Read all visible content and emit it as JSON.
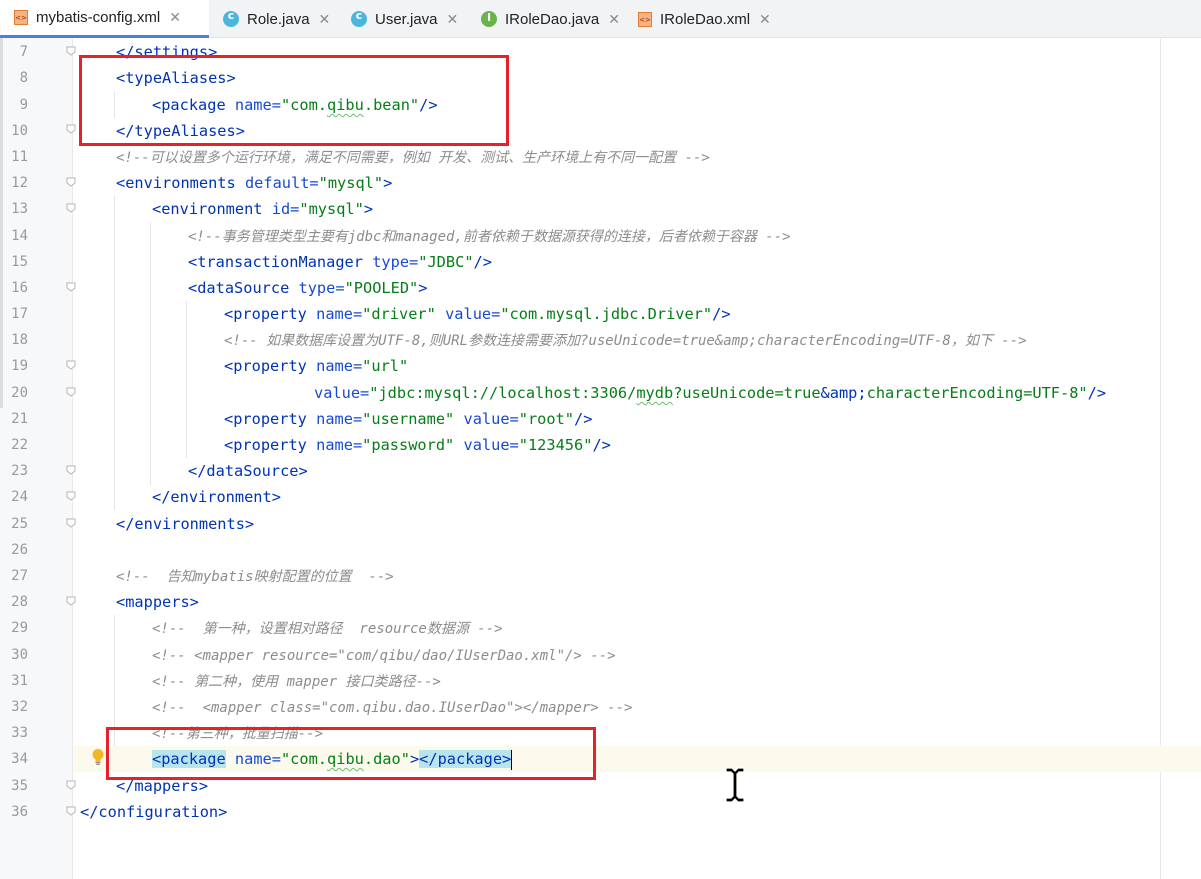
{
  "tabs": [
    {
      "label": "mybatis-config.xml",
      "icon": "xml-file-icon",
      "active": true
    },
    {
      "label": "Role.java",
      "icon": "class-icon"
    },
    {
      "label": "User.java",
      "icon": "class-icon"
    },
    {
      "label": "IRoleDao.java",
      "icon": "interface-icon"
    },
    {
      "label": "IRoleDao.xml",
      "icon": "xml-file-icon"
    }
  ],
  "close_glyph": "✕",
  "line_numbers": [
    "7",
    "8",
    "9",
    "10",
    "11",
    "12",
    "13",
    "14",
    "15",
    "16",
    "17",
    "18",
    "19",
    "20",
    "21",
    "22",
    "23",
    "24",
    "25",
    "26",
    "27",
    "28",
    "29",
    "30",
    "31",
    "32",
    "33",
    "34",
    "35",
    "36"
  ],
  "code": {
    "l7": "</settings>",
    "l8_tag": "<typeAliases>",
    "l9_open": "<package ",
    "l9_attr": "name=",
    "l9_val_q1": "\"com.",
    "l9_val_sq": "qibu",
    "l9_val_q2": ".bean\"",
    "l9_close": "/>",
    "l10": "</typeAliases>",
    "l11": "<!--可以设置多个运行环境，满足不同需要，例如 开发、测试、生产环境上有不同一配置 -->",
    "l12_open": "<environments ",
    "l12_attr": "default=",
    "l12_val": "\"mysql\"",
    "l12_close": ">",
    "l13_open": "<environment ",
    "l13_attr": "id=",
    "l13_val": "\"mysql\"",
    "l13_close": ">",
    "l14": "<!--事务管理类型主要有jdbc和managed,前者依赖于数据源获得的连接，后者依赖于容器 -->",
    "l15_open": "<transactionManager ",
    "l15_attr": "type=",
    "l15_val": "\"JDBC\"",
    "l15_close": "/>",
    "l16_open": "<dataSource ",
    "l16_attr": "type=",
    "l16_val": "\"POOLED\"",
    "l16_close": ">",
    "l17_open": "<property ",
    "l17_a1": "name=",
    "l17_v1": "\"driver\"",
    "l17_a2": " value=",
    "l17_v2": "\"com.mysql.jdbc.Driver\"",
    "l17_close": "/>",
    "l18": "<!-- 如果数据库设置为UTF-8,则URL参数连接需要添加?useUnicode=true&amp;characterEncoding=UTF-8，如下 -->",
    "l19_open": "<property ",
    "l19_a1": "name=",
    "l19_v1": "\"url\"",
    "l20_attr": "value=",
    "l20_v_a": "\"jdbc:mysql://localhost:3306/",
    "l20_v_sq": "mydb",
    "l20_v_b": "?useUnicode=true",
    "l20_amp": "&amp;",
    "l20_v_c": "characterEncoding=UTF-8\"",
    "l20_close": "/>",
    "l21_open": "<property ",
    "l21_a1": "name=",
    "l21_v1": "\"username\"",
    "l21_a2": " value=",
    "l21_v2": "\"root\"",
    "l21_close": "/>",
    "l22_open": "<property ",
    "l22_a1": "name=",
    "l22_v1": "\"password\"",
    "l22_a2": " value=",
    "l22_v2": "\"123456\"",
    "l22_close": "/>",
    "l23": "</dataSource>",
    "l24": "</environment>",
    "l25": "</environments>",
    "l27": "<!--  告知mybatis映射配置的位置  -->",
    "l28": "<mappers>",
    "l29": "<!--  第一种，设置相对路径  resource数据源 -->",
    "l30": "<!-- <mapper resource=\"com/qibu/dao/IUserDao.xml\"/> -->",
    "l31": "<!-- 第二种，使用 mapper 接口类路径-->",
    "l32": "<!--  <mapper class=\"com.qibu.dao.IUserDao\"></mapper> -->",
    "l33": "<!--第三种，批量扫描-->",
    "l34_open": "<package",
    "l34_attr": "name=",
    "l34_val_a": "\"com.",
    "l34_val_sq": "qibu",
    "l34_val_b": ".dao\"",
    "l34_gt": ">",
    "l34_close": "</package>",
    "l35": "</mappers>",
    "l36": "</configuration>"
  },
  "colors": {
    "tag": "#0033b3",
    "attribute": "#174ad4",
    "value": "#067d17",
    "comment": "#8c8c8c",
    "highlight_box": "#e8202a",
    "active_tab_underline": "#4a7ee0"
  }
}
